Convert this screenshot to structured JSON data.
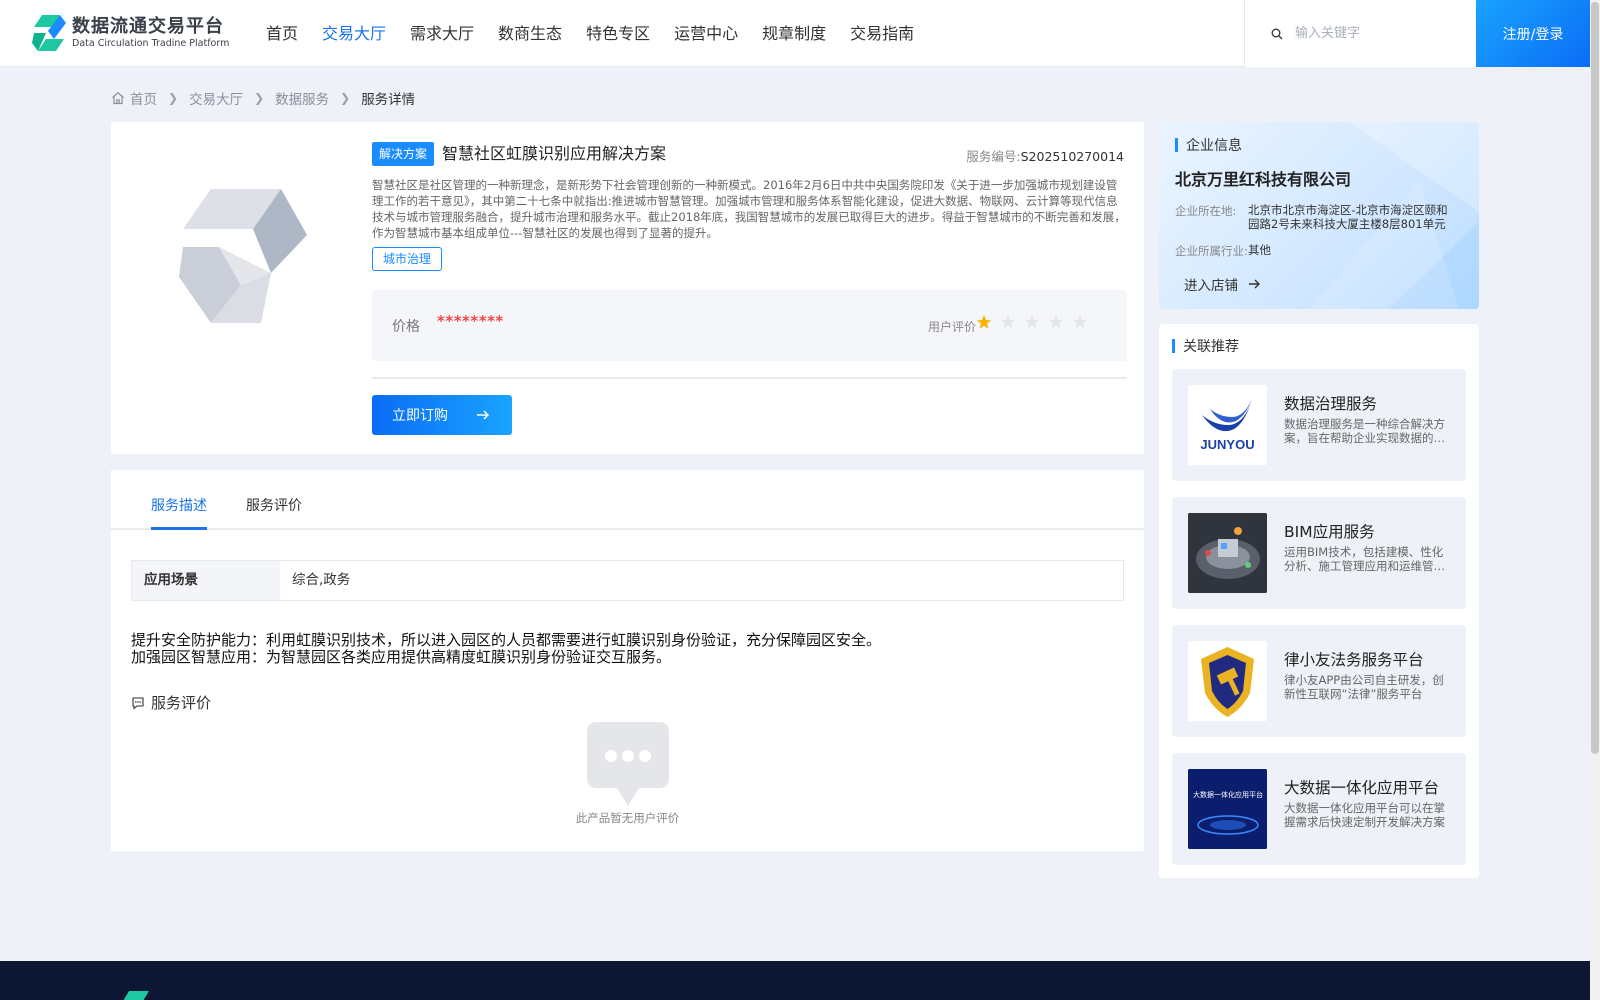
{
  "header": {
    "logo_cn": "数据流通交易平台",
    "logo_en": "Data Circulation Tradine Platform",
    "nav": [
      "首页",
      "交易大厅",
      "需求大厅",
      "数商生态",
      "特色专区",
      "运营中心",
      "规章制度",
      "交易指南"
    ],
    "active_nav": "交易大厅",
    "search_placeholder": "输入关键字",
    "login_label": "注册/登录"
  },
  "breadcrumb": [
    "首页",
    "交易大厅",
    "数据服务",
    "服务详情"
  ],
  "service": {
    "tag": "解决方案",
    "title": "智慧社区虹膜识别应用解决方案",
    "number_label": "服务编号:",
    "number": "S202510270014",
    "description": "智慧社区是社区管理的一种新理念，是新形势下社会管理创新的一种新模式。2016年2月6日中共中央国务院印发《关于进一步加强城市规划建设管理工作的若干意见》，其中第二十七条中就指出:推进城市智慧管理。加强城市管理和服务体系智能化建设，促进大数据、物联网、云计算等现代信息技术与城市管理服务融合，提升城市治理和服务水平。截止2018年底，我国智慧城市的发展已取得巨大的进步。得益于智慧城市的不断完善和发展，作为智慧城市基本组成单位---智慧社区的发展也得到了显著的提升。",
    "category_tag": "城市治理",
    "price_label": "价格",
    "price_value": "********",
    "rating_label": "用户评价",
    "rating": 1,
    "rating_max": 5,
    "buy_label": "立即订购"
  },
  "enterprise": {
    "heading": "企业信息",
    "name": "北京万里红科技有限公司",
    "location_label": "企业所在地:",
    "location": "北京市北京市海淀区-北京市海淀区颐和园路2号未来科技大厦主楼8层801单元",
    "industry_label": "企业所属行业:",
    "industry": "其他",
    "enter_shop": "进入店铺"
  },
  "related": {
    "heading": "关联推荐",
    "items": [
      {
        "title": "数据治理服务",
        "desc": "数据治理服务是一种综合解决方案，旨在帮助企业实现数据的规范化管理与价值提升",
        "thumb": "junyou-logo",
        "thumb_text": "JUNYOU"
      },
      {
        "title": "BIM应用服务",
        "desc": "运用BIM技术，包括建模、性化分析、施工管理应用和运维管理等服务",
        "thumb": "bim-image",
        "thumb_text": ""
      },
      {
        "title": "律小友法务服务平台",
        "desc": "律小友APP由公司自主研发，创新性互联网“法律”服务平台",
        "thumb": "law-shield-logo",
        "thumb_text": ""
      },
      {
        "title": "大数据一体化应用平台",
        "desc": "大数据一体化应用平台可以在掌握需求后快速定制开发解决方案",
        "thumb": "bigdata-image",
        "thumb_text": "大数据一体化应用平台"
      }
    ]
  },
  "tabs": {
    "items": [
      "服务描述",
      "服务评价"
    ],
    "active": "服务描述"
  },
  "attributes": {
    "key": "应用场景",
    "value": "综合,政务"
  },
  "body_lines": [
    "提升安全防护能力：利用虹膜识别技术，所以进入园区的人员都需要进行虹膜识别身份验证，充分保障园区安全。",
    "加强园区智慧应用：为智慧园区各类应用提供高精度虹膜识别身份验证交互服务。"
  ],
  "reviews": {
    "heading": "服务评价",
    "empty_text": "此产品暂无用户评价"
  },
  "colors": {
    "primary": "#1a8cff",
    "active_text": "#1a73e8",
    "price": "#f04848",
    "star_on": "#f5b400",
    "star_off": "#e3e5ea",
    "footer": "#0d1633"
  }
}
